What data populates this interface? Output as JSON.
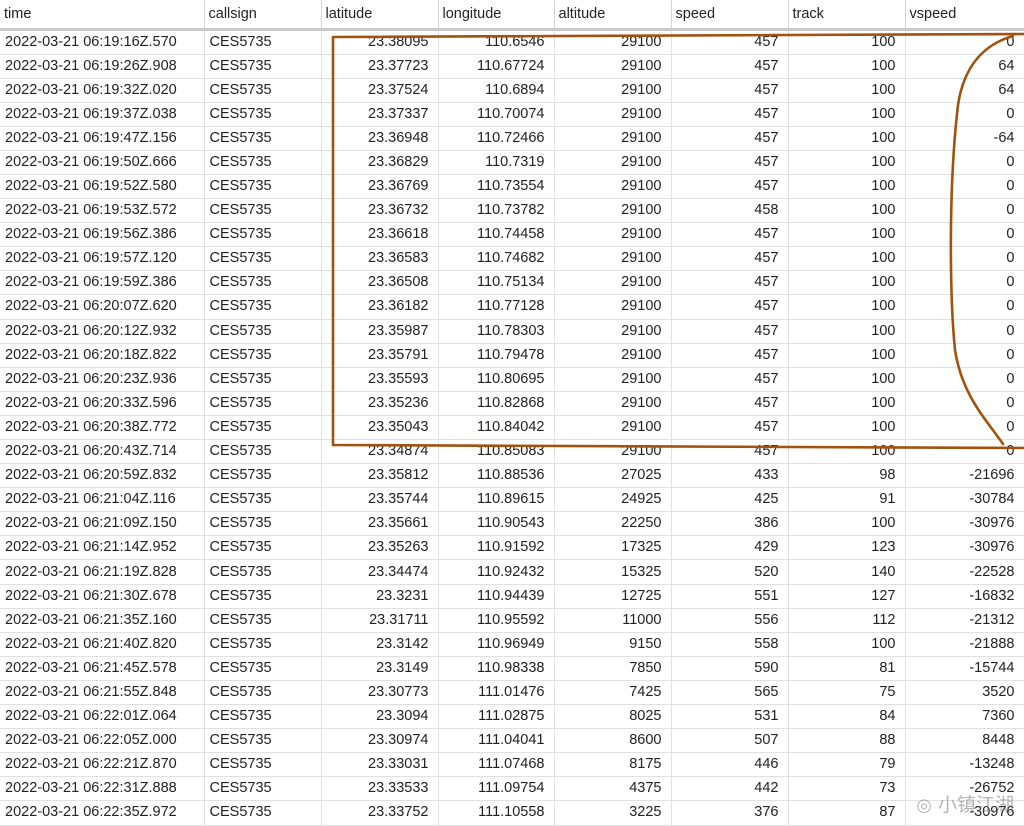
{
  "columns": [
    "time",
    "callsign",
    "latitude",
    "longitude",
    "altitude",
    "speed",
    "track",
    "vspeed"
  ],
  "rows": [
    [
      "2022-03-21 06:19:16Z.570",
      "CES5735",
      "23.38095",
      "110.6546",
      "29100",
      "457",
      "100",
      "0"
    ],
    [
      "2022-03-21 06:19:26Z.908",
      "CES5735",
      "23.37723",
      "110.67724",
      "29100",
      "457",
      "100",
      "64"
    ],
    [
      "2022-03-21 06:19:32Z.020",
      "CES5735",
      "23.37524",
      "110.6894",
      "29100",
      "457",
      "100",
      "64"
    ],
    [
      "2022-03-21 06:19:37Z.038",
      "CES5735",
      "23.37337",
      "110.70074",
      "29100",
      "457",
      "100",
      "0"
    ],
    [
      "2022-03-21 06:19:47Z.156",
      "CES5735",
      "23.36948",
      "110.72466",
      "29100",
      "457",
      "100",
      "-64"
    ],
    [
      "2022-03-21 06:19:50Z.666",
      "CES5735",
      "23.36829",
      "110.7319",
      "29100",
      "457",
      "100",
      "0"
    ],
    [
      "2022-03-21 06:19:52Z.580",
      "CES5735",
      "23.36769",
      "110.73554",
      "29100",
      "457",
      "100",
      "0"
    ],
    [
      "2022-03-21 06:19:53Z.572",
      "CES5735",
      "23.36732",
      "110.73782",
      "29100",
      "458",
      "100",
      "0"
    ],
    [
      "2022-03-21 06:19:56Z.386",
      "CES5735",
      "23.36618",
      "110.74458",
      "29100",
      "457",
      "100",
      "0"
    ],
    [
      "2022-03-21 06:19:57Z.120",
      "CES5735",
      "23.36583",
      "110.74682",
      "29100",
      "457",
      "100",
      "0"
    ],
    [
      "2022-03-21 06:19:59Z.386",
      "CES5735",
      "23.36508",
      "110.75134",
      "29100",
      "457",
      "100",
      "0"
    ],
    [
      "2022-03-21 06:20:07Z.620",
      "CES5735",
      "23.36182",
      "110.77128",
      "29100",
      "457",
      "100",
      "0"
    ],
    [
      "2022-03-21 06:20:12Z.932",
      "CES5735",
      "23.35987",
      "110.78303",
      "29100",
      "457",
      "100",
      "0"
    ],
    [
      "2022-03-21 06:20:18Z.822",
      "CES5735",
      "23.35791",
      "110.79478",
      "29100",
      "457",
      "100",
      "0"
    ],
    [
      "2022-03-21 06:20:23Z.936",
      "CES5735",
      "23.35593",
      "110.80695",
      "29100",
      "457",
      "100",
      "0"
    ],
    [
      "2022-03-21 06:20:33Z.596",
      "CES5735",
      "23.35236",
      "110.82868",
      "29100",
      "457",
      "100",
      "0"
    ],
    [
      "2022-03-21 06:20:38Z.772",
      "CES5735",
      "23.35043",
      "110.84042",
      "29100",
      "457",
      "100",
      "0"
    ],
    [
      "2022-03-21 06:20:43Z.714",
      "CES5735",
      "23.34874",
      "110.85083",
      "29100",
      "457",
      "100",
      "0"
    ],
    [
      "2022-03-21 06:20:59Z.832",
      "CES5735",
      "23.35812",
      "110.88536",
      "27025",
      "433",
      "98",
      "-21696"
    ],
    [
      "2022-03-21 06:21:04Z.116",
      "CES5735",
      "23.35744",
      "110.89615",
      "24925",
      "425",
      "91",
      "-30784"
    ],
    [
      "2022-03-21 06:21:09Z.150",
      "CES5735",
      "23.35661",
      "110.90543",
      "22250",
      "386",
      "100",
      "-30976"
    ],
    [
      "2022-03-21 06:21:14Z.952",
      "CES5735",
      "23.35263",
      "110.91592",
      "17325",
      "429",
      "123",
      "-30976"
    ],
    [
      "2022-03-21 06:21:19Z.828",
      "CES5735",
      "23.34474",
      "110.92432",
      "15325",
      "520",
      "140",
      "-22528"
    ],
    [
      "2022-03-21 06:21:30Z.678",
      "CES5735",
      "23.3231",
      "110.94439",
      "12725",
      "551",
      "127",
      "-16832"
    ],
    [
      "2022-03-21 06:21:35Z.160",
      "CES5735",
      "23.31711",
      "110.95592",
      "11000",
      "556",
      "112",
      "-21312"
    ],
    [
      "2022-03-21 06:21:40Z.820",
      "CES5735",
      "23.3142",
      "110.96949",
      "9150",
      "558",
      "100",
      "-21888"
    ],
    [
      "2022-03-21 06:21:45Z.578",
      "CES5735",
      "23.3149",
      "110.98338",
      "7850",
      "590",
      "81",
      "-15744"
    ],
    [
      "2022-03-21 06:21:55Z.848",
      "CES5735",
      "23.30773",
      "111.01476",
      "7425",
      "565",
      "75",
      "3520"
    ],
    [
      "2022-03-21 06:22:01Z.064",
      "CES5735",
      "23.3094",
      "111.02875",
      "8025",
      "531",
      "84",
      "7360"
    ],
    [
      "2022-03-21 06:22:05Z.000",
      "CES5735",
      "23.30974",
      "111.04041",
      "8600",
      "507",
      "88",
      "8448"
    ],
    [
      "2022-03-21 06:22:21Z.870",
      "CES5735",
      "23.33031",
      "111.07468",
      "8175",
      "446",
      "79",
      "-13248"
    ],
    [
      "2022-03-21 06:22:31Z.888",
      "CES5735",
      "23.33533",
      "111.09754",
      "4375",
      "442",
      "73",
      "-26752"
    ],
    [
      "2022-03-21 06:22:35Z.972",
      "CES5735",
      "23.33752",
      "111.10558",
      "3225",
      "376",
      "87",
      "-30976"
    ]
  ],
  "annotation": {
    "color": "#a0520e"
  },
  "watermark": {
    "text": "小镇江湖"
  },
  "colors": {
    "grid_line": "#e1e1e1",
    "header_rule": "#c9c9c9",
    "text": "#222222"
  }
}
